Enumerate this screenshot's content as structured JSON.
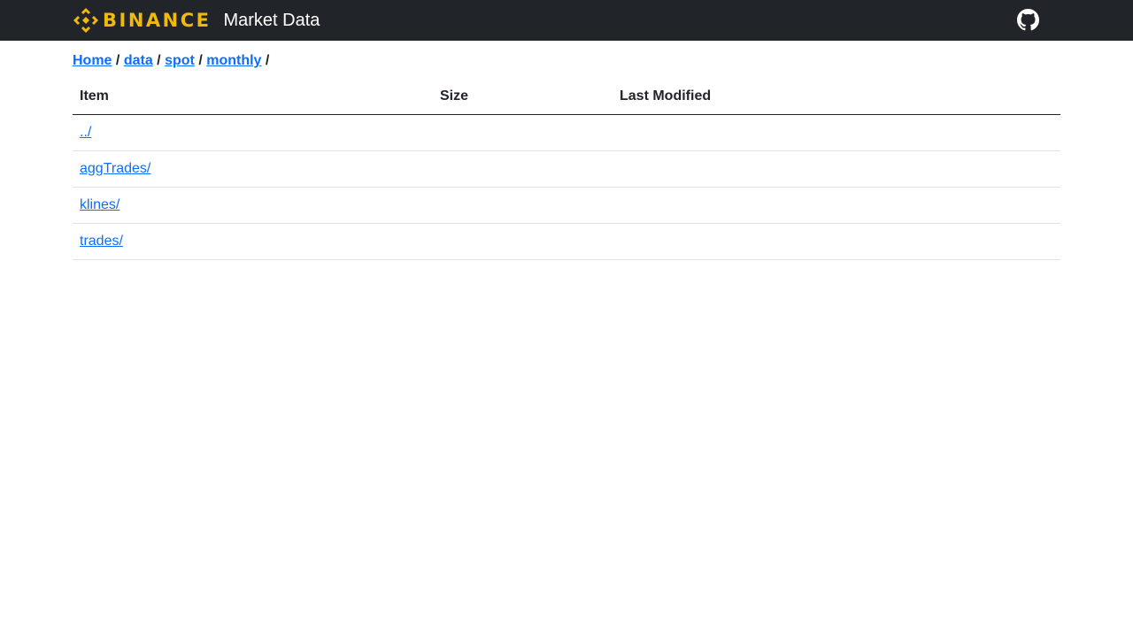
{
  "header": {
    "brand_wordmark": "BINANCE",
    "title": "Market Data",
    "brand_color": "#F0B90B",
    "background_color": "#212529",
    "github_icon": "github-icon"
  },
  "breadcrumb": {
    "items": [
      "Home",
      "data",
      "spot",
      "monthly"
    ],
    "separator": "/"
  },
  "table": {
    "columns": [
      "Item",
      "Size",
      "Last Modified"
    ],
    "rows": [
      {
        "item": "../",
        "size": "",
        "modified": ""
      },
      {
        "item": "aggTrades/",
        "size": "",
        "modified": ""
      },
      {
        "item": "klines/",
        "size": "",
        "modified": ""
      },
      {
        "item": "trades/",
        "size": "",
        "modified": ""
      }
    ]
  },
  "colors": {
    "link": "#0d6efd",
    "text": "#212529",
    "row_border": "#dee2e6"
  }
}
